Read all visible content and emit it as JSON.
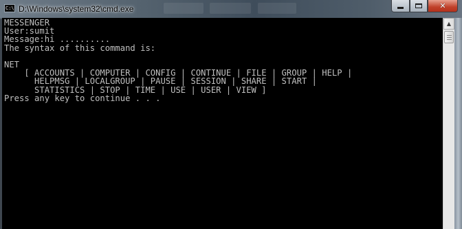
{
  "window": {
    "title": "D:\\Windows\\system32\\cmd.exe",
    "app_icon_text": "C:\\"
  },
  "controls": {
    "minimize": "minimize",
    "maximize": "maximize",
    "close_symbol": "✕"
  },
  "console": {
    "lines": [
      "MESSENGER",
      "User:sumit",
      "Message:hi ..........",
      "The syntax of this command is:",
      "",
      "NET",
      "    [ ACCOUNTS | COMPUTER | CONFIG | CONTINUE | FILE | GROUP | HELP |",
      "      HELPMSG | LOCALGROUP | PAUSE | SESSION | SHARE | START |",
      "      STATISTICS | STOP | TIME | USE | USER | VIEW ]",
      "Press any key to continue . . ."
    ]
  },
  "scrollbar": {
    "up_arrow": "▲"
  },
  "colors": {
    "console_bg": "#000000",
    "console_text": "#c0c0c0"
  }
}
